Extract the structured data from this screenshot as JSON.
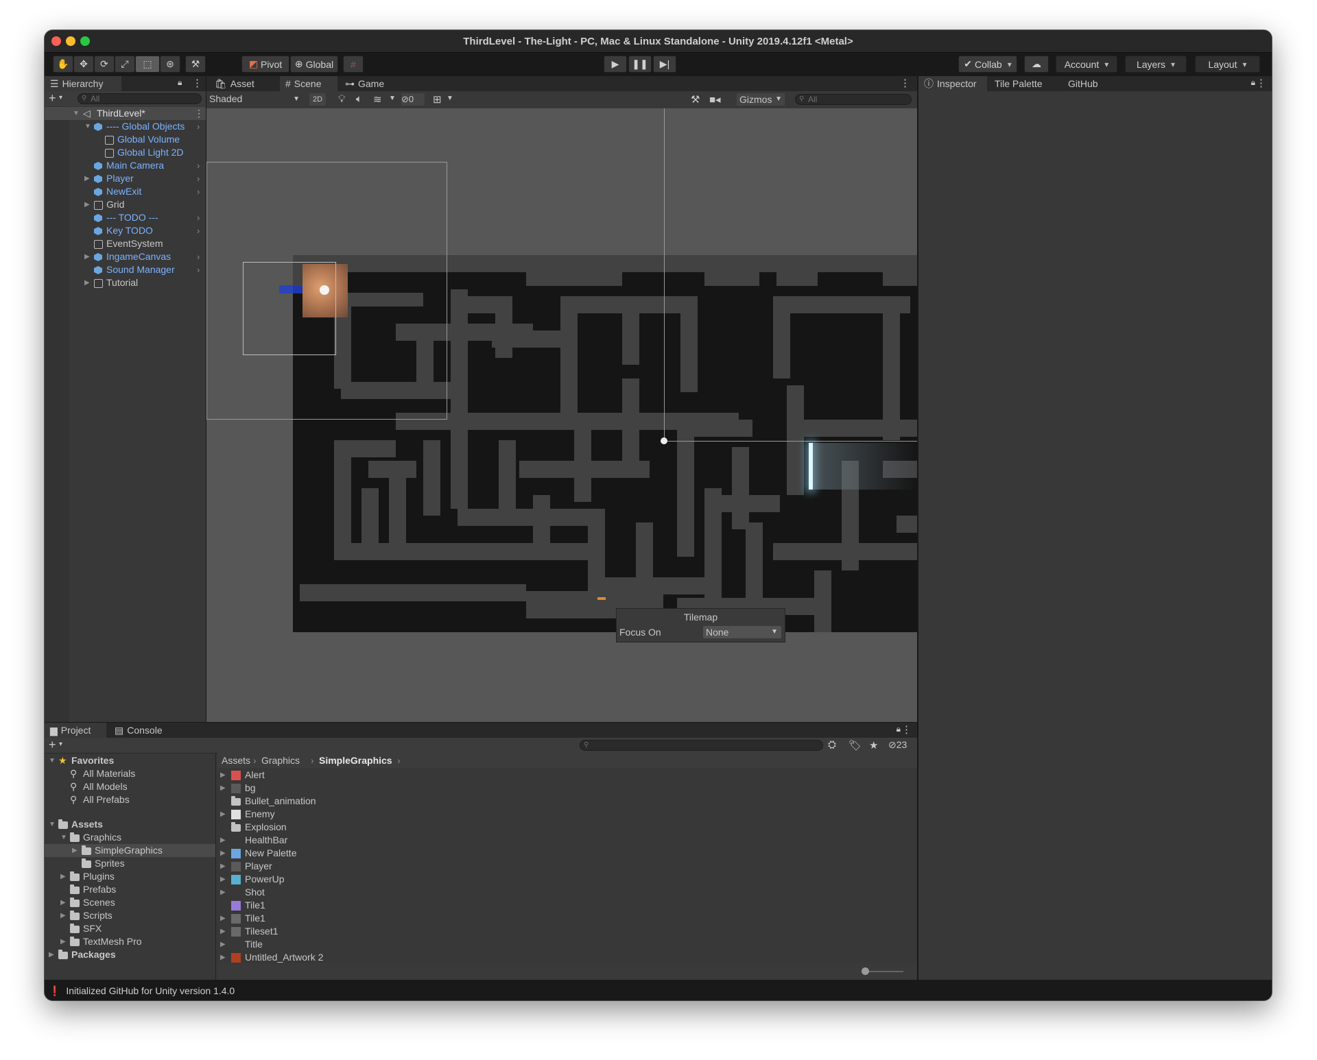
{
  "window": {
    "title": "ThirdLevel - The-Light - PC, Mac & Linux Standalone - Unity 2019.4.12f1 <Metal>"
  },
  "toolbar": {
    "pivot_label": "Pivot",
    "global_label": "Global",
    "collab_label": "Collab",
    "account_label": "Account",
    "layers_label": "Layers",
    "layout_label": "Layout"
  },
  "hierarchy": {
    "tab_label": "Hierarchy",
    "search_placeholder": "All",
    "scene_name": "ThirdLevel*",
    "items": [
      {
        "label": "---- Global Objects",
        "depth": 1
      },
      {
        "label": "Global Volume",
        "depth": 2
      },
      {
        "label": "Global Light 2D",
        "depth": 2
      },
      {
        "label": "Main Camera",
        "depth": 1
      },
      {
        "label": "Player",
        "depth": 1
      },
      {
        "label": "NewExit",
        "depth": 1
      },
      {
        "label": "Grid",
        "depth": 1
      },
      {
        "label": "--- TODO ---",
        "depth": 1
      },
      {
        "label": "Key TODO",
        "depth": 1
      },
      {
        "label": "EventSystem",
        "depth": 1
      },
      {
        "label": "IngameCanvas",
        "depth": 1
      },
      {
        "label": "Sound Manager",
        "depth": 1
      },
      {
        "label": "Tutorial",
        "depth": 1
      }
    ]
  },
  "scene_view": {
    "tabs": [
      "Asset Store",
      "Scene",
      "Game"
    ],
    "shading_mode": "Shaded",
    "mode_2d": "2D",
    "hidden_count": "0",
    "gizmos_label": "Gizmos",
    "search_placeholder": "All",
    "overlay": {
      "title": "Tilemap",
      "focus_label": "Focus On",
      "focus_value": "None"
    }
  },
  "inspector": {
    "tabs": [
      "Inspector",
      "Tile Palette",
      "GitHub"
    ]
  },
  "project": {
    "tabs": [
      "Project",
      "Console"
    ],
    "favorites_label": "Favorites",
    "favorites": [
      "All Materials",
      "All Models",
      "All Prefabs"
    ],
    "assets_label": "Assets",
    "tree": [
      "Graphics",
      "SimpleGraphics",
      "Sprites",
      "Plugins",
      "Prefabs",
      "Scenes",
      "Scripts",
      "SFX",
      "TextMesh Pro"
    ],
    "packages_label": "Packages",
    "breadcrumb": [
      "Assets",
      "Graphics",
      "SimpleGraphics"
    ],
    "hidden_count": "23",
    "files": [
      {
        "name": "Alert",
        "color": "#d95050"
      },
      {
        "name": "bg",
        "color": "#5a5a5a"
      },
      {
        "name": "Bullet_animation",
        "color": "folder"
      },
      {
        "name": "Enemy",
        "color": "#e0e0e0"
      },
      {
        "name": "Explosion",
        "color": "folder"
      },
      {
        "name": "HealthBar",
        "color": "#383838"
      },
      {
        "name": "New Palette",
        "color": "#6aa7e0"
      },
      {
        "name": "Player",
        "color": "#5a5a5a"
      },
      {
        "name": "PowerUp",
        "color": "#5ab0d0"
      },
      {
        "name": "Shot",
        "color": "#383838"
      },
      {
        "name": "Tile1",
        "color": "#9a7ad8"
      },
      {
        "name": "Tile1",
        "color": "#6a6a6a"
      },
      {
        "name": "Tileset1",
        "color": "#6a6a6a"
      },
      {
        "name": "Title",
        "color": "#383838"
      },
      {
        "name": "Untitled_Artwork 2",
        "color": "#b04020"
      }
    ]
  },
  "status": {
    "message": "Initialized GitHub for Unity version 1.4.0"
  }
}
